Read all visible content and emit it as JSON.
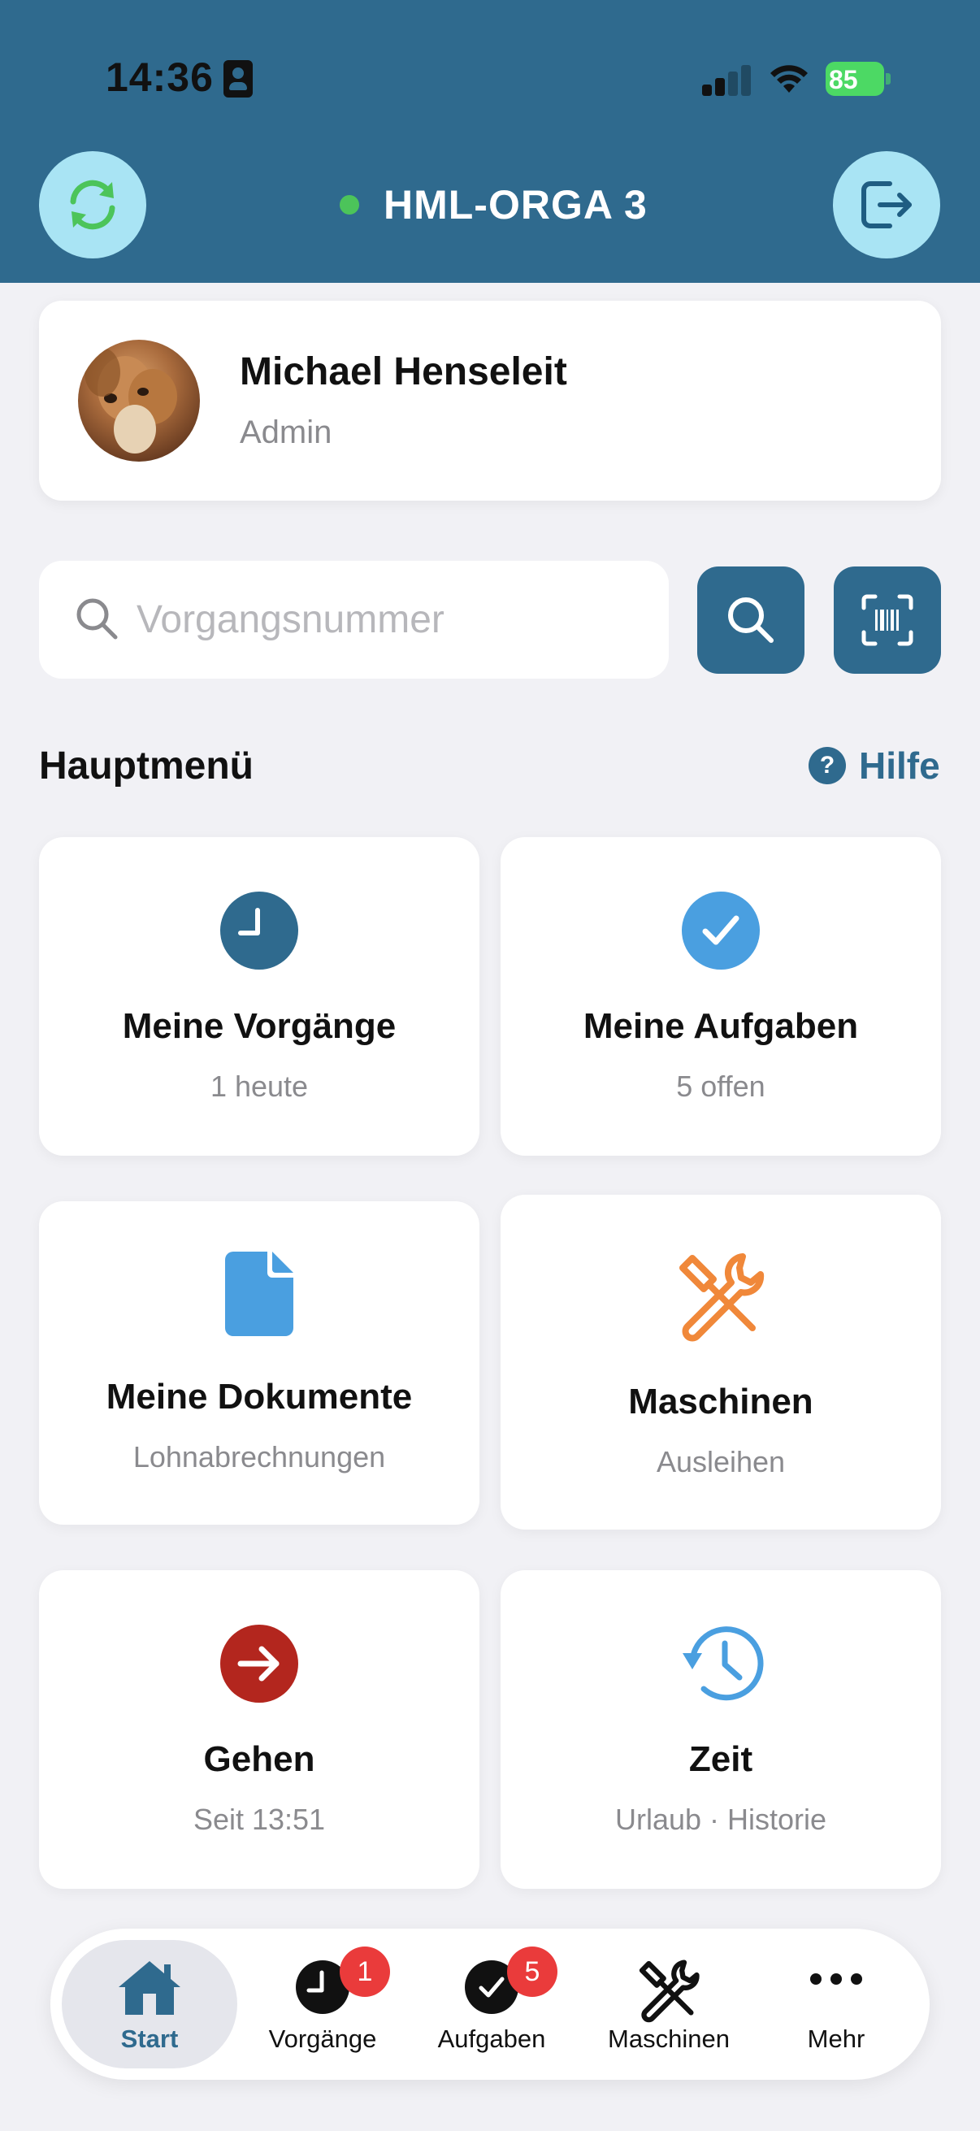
{
  "status_bar": {
    "time": "14:36",
    "battery": "85"
  },
  "header": {
    "title": "HML-ORGA 3",
    "online_color": "#4cc45a",
    "accent": "#2f6a8e"
  },
  "profile": {
    "name": "Michael Henseleit",
    "role": "Admin"
  },
  "search": {
    "placeholder": "Vorgangsnummer",
    "value": ""
  },
  "main_menu": {
    "title": "Hauptmenü",
    "help_label": "Hilfe",
    "tiles": [
      {
        "title": "Meine Vorgänge",
        "subtitle": "1 heute",
        "icon": "clock-icon",
        "color": "#2f6a8e"
      },
      {
        "title": "Meine Aufgaben",
        "subtitle": "5 offen",
        "icon": "check-circle-icon",
        "color": "#4a9fe0"
      },
      {
        "title": "Meine Dokumente",
        "subtitle": "Lohnabrechnungen",
        "icon": "document-icon",
        "color": "#4a9fe0"
      },
      {
        "title": "Maschinen",
        "subtitle": "Ausleihen",
        "icon": "tools-icon",
        "color": "#f0883a"
      },
      {
        "title": "Gehen",
        "subtitle": "Seit 13:51",
        "icon": "arrow-right-circle-icon",
        "color": "#b3261e"
      },
      {
        "title": "Zeit",
        "subtitle": "Urlaub · Historie",
        "icon": "history-clock-icon",
        "color": "#4a9fe0"
      }
    ]
  },
  "tabbar": {
    "items": [
      {
        "label": "Start",
        "icon": "home-icon",
        "active": true
      },
      {
        "label": "Vorgänge",
        "icon": "clock-icon",
        "badge": "1"
      },
      {
        "label": "Aufgaben",
        "icon": "check-circle-icon",
        "badge": "5"
      },
      {
        "label": "Maschinen",
        "icon": "tools-icon"
      },
      {
        "label": "Mehr",
        "icon": "more-icon"
      }
    ]
  }
}
